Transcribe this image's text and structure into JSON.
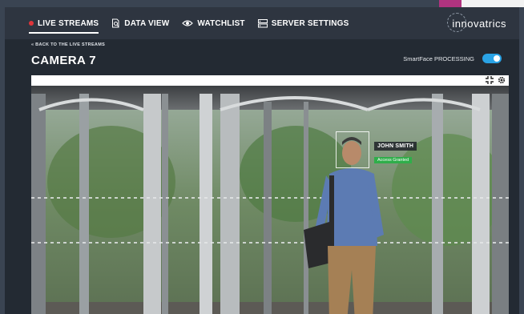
{
  "nav": {
    "items": [
      {
        "label": "LIVE STREAMS",
        "active": true
      },
      {
        "label": "DATA VIEW",
        "active": false
      },
      {
        "label": "WATCHLIST",
        "active": false
      },
      {
        "label": "SERVER SETTINGS",
        "active": false
      }
    ]
  },
  "brand": {
    "name": "innovatrics"
  },
  "page": {
    "back_link": "« BACK TO THE LIVE STREAMS",
    "title": "CAMERA 7",
    "processing_label": "SmartFace PROCESSING",
    "processing_on": true
  },
  "detection": {
    "name": "JOHN SMITH",
    "status": "Access Granted"
  },
  "colors": {
    "accent": "#2aa3e5",
    "live_dot": "#e0353a",
    "granted": "#2fae4a",
    "brand_pink": "#b0337f"
  },
  "icons": {
    "live": "live-dot-icon",
    "data_view": "document-search-icon",
    "watchlist": "eye-icon",
    "settings": "server-settings-icon",
    "fullscreen": "fullscreen-icon",
    "gear": "gear-icon"
  }
}
